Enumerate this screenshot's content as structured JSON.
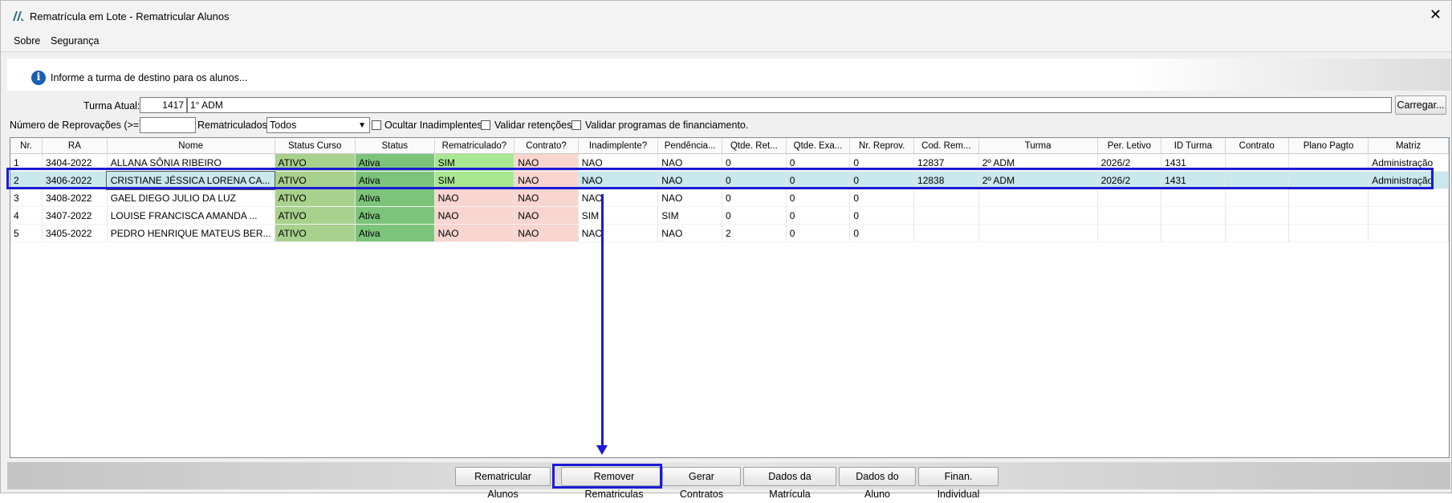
{
  "window": {
    "title": "Rematrícula em Lote - Rematricular Alunos",
    "close": "✕"
  },
  "menu": [
    "Sobre",
    "Segurança"
  ],
  "banner": {
    "message": "Informe a turma de destino para os alunos..."
  },
  "filters": {
    "turma_label": "Turma Atual:",
    "turma_code": "1417",
    "turma_name": "1° ADM",
    "load_button": "Carregar...",
    "reprov_label": "Número de Reprovações (>=):",
    "reprov_value": "",
    "remat_label": "Rematriculados:",
    "remat_value": "Todos",
    "opt_ocultar": "Ocultar Inadimplentes",
    "opt_retencoes": "Validar retenções.",
    "opt_financ": "Validar programas de financiamento."
  },
  "table": {
    "columns": [
      "Nr.",
      "RA",
      "Nome",
      "Status Curso",
      "Status",
      "Rematriculado?",
      "Contrato?",
      "Inadimplente?",
      "Pendência...",
      "Qtde. Ret...",
      "Qtde. Exa...",
      "Nr. Reprov.",
      "Cod. Rem...",
      "Turma",
      "Per. Letivo",
      "ID Turma",
      "Contrato",
      "Plano Pagto",
      "Matriz"
    ],
    "rows": [
      [
        "1",
        "3404-2022",
        "ALLANA SÔNIA RIBEIRO",
        "ATIVO",
        "Ativa",
        "SIM",
        "NAO",
        "NAO",
        "NAO",
        "0",
        "0",
        "0",
        "12837",
        "2º ADM",
        "2026/2",
        "1431",
        "",
        "",
        "Administração"
      ],
      [
        "2",
        "3406-2022",
        "CRISTIANE JÉSSICA LORENA CA...",
        "ATIVO",
        "Ativa",
        "SIM",
        "NAO",
        "NAO",
        "NAO",
        "0",
        "0",
        "0",
        "12838",
        "2º ADM",
        "2026/2",
        "1431",
        "",
        "",
        "Administração"
      ],
      [
        "3",
        "3408-2022",
        "GAEL DIEGO JULIO DA LUZ",
        "ATIVO",
        "Ativa",
        "NAO",
        "NAO",
        "NAO",
        "NAO",
        "0",
        "0",
        "0",
        "",
        "",
        "",
        "",
        "",
        "",
        ""
      ],
      [
        "4",
        "3407-2022",
        "LOUISE FRANCISCA AMANDA ...",
        "ATIVO",
        "Ativa",
        "NAO",
        "NAO",
        "SIM",
        "SIM",
        "0",
        "0",
        "0",
        "",
        "",
        "",
        "",
        "",
        "",
        ""
      ],
      [
        "5",
        "3405-2022",
        "PEDRO HENRIQUE MATEUS BER...",
        "ATIVO",
        "Ativa",
        "NAO",
        "NAO",
        "NAO",
        "NAO",
        "2",
        "0",
        "0",
        "",
        "",
        "",
        "",
        "",
        "",
        ""
      ]
    ],
    "selected_row": 1
  },
  "buttons": [
    "Rematricular Alunos",
    "Remover Rematriculas",
    "Gerar Contratos",
    "Dados da Matrícula",
    "Dados do Aluno",
    "Finan. Individual"
  ],
  "colors": {
    "accent": "#1b1bd6",
    "status_green": "#a9d18e",
    "ativa_green": "#7cc47b",
    "sim_green": "#a8e890",
    "nao_red": "#f9d5cf",
    "selected_row": "#c9e8eb"
  }
}
